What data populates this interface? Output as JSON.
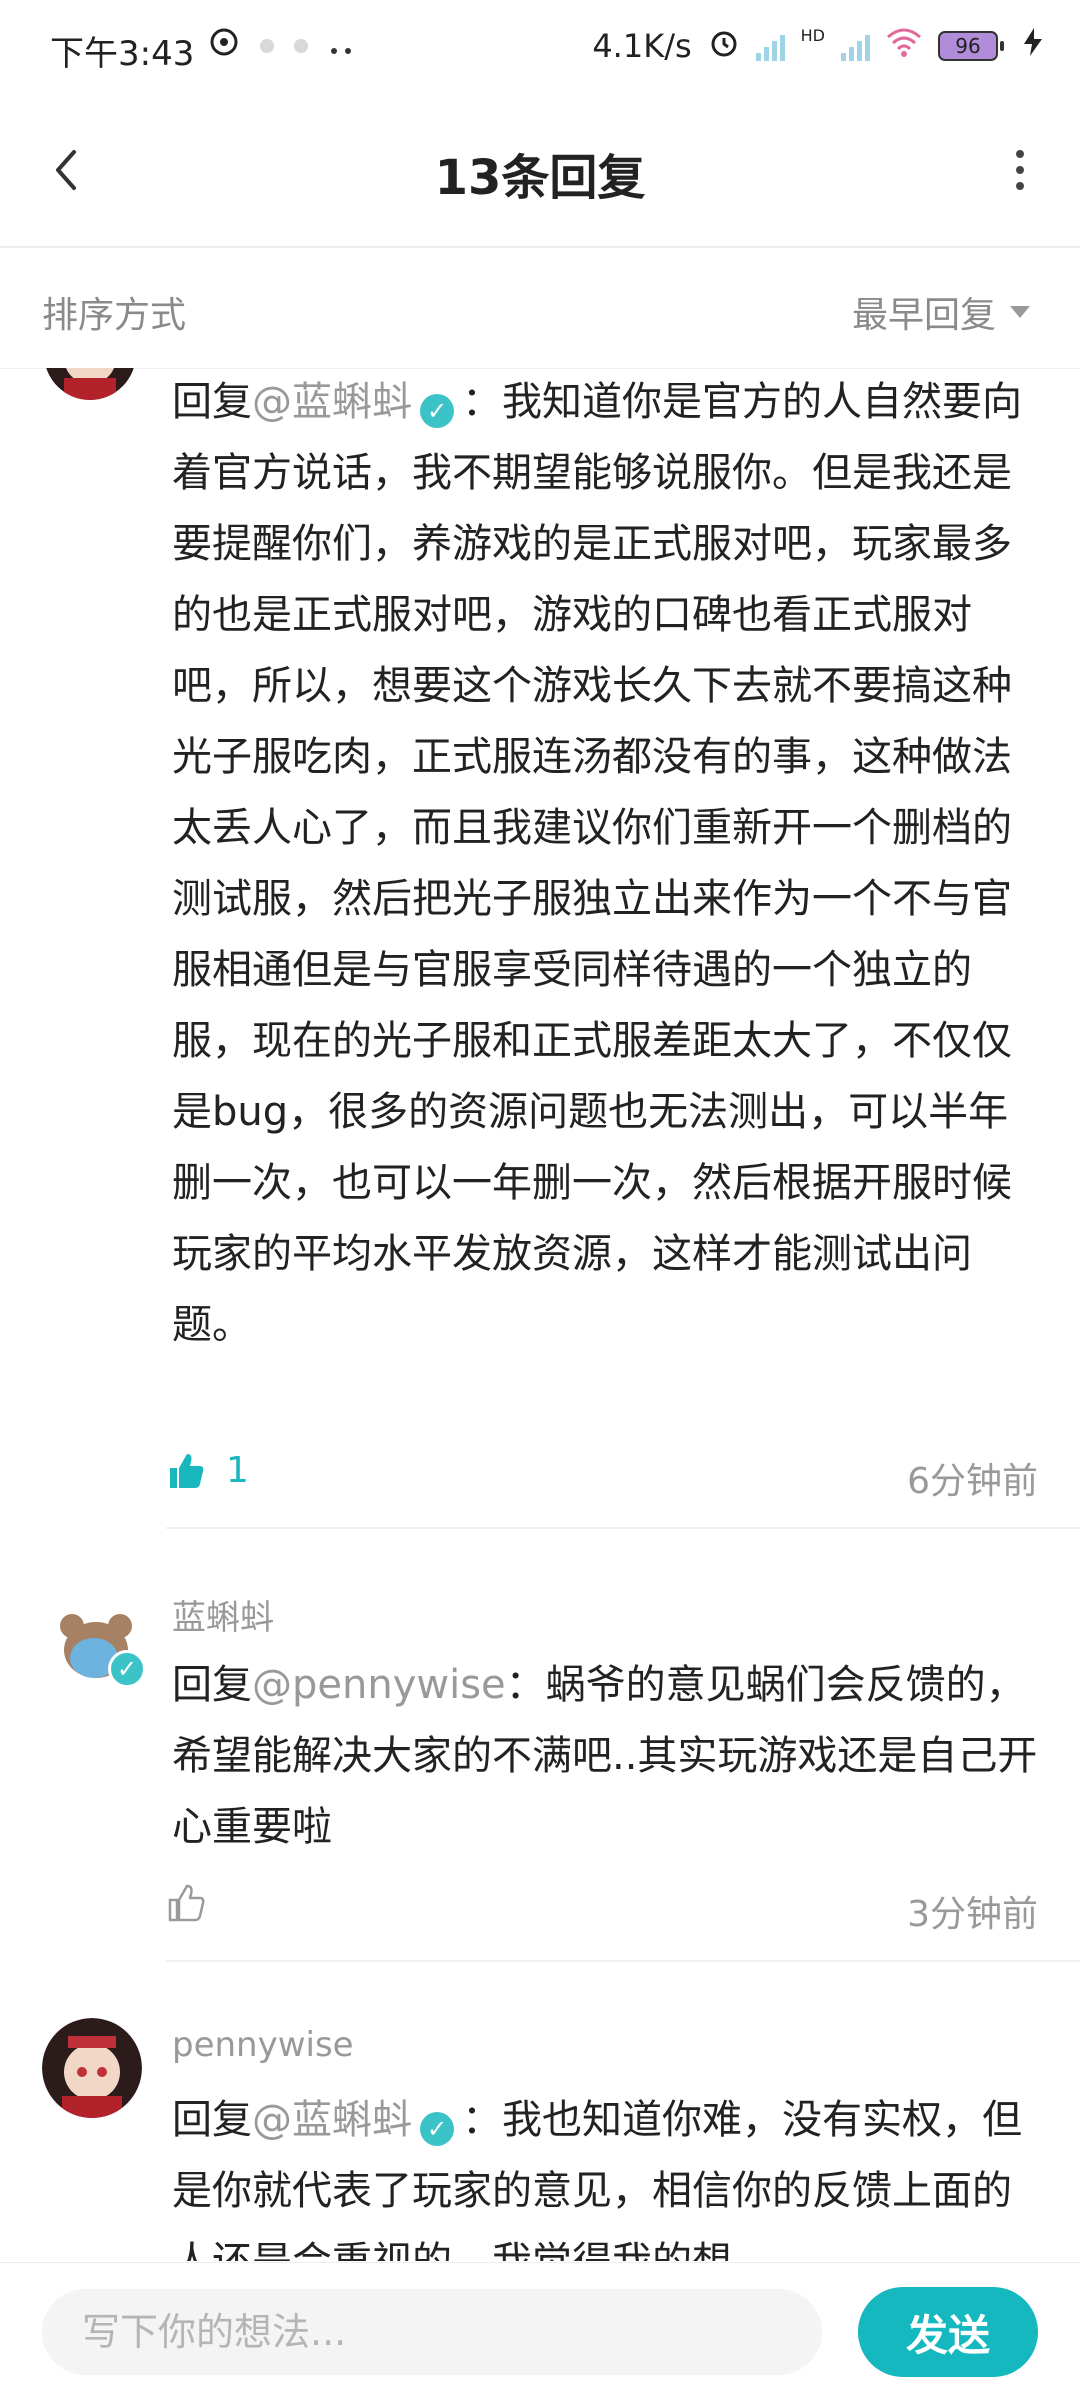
{
  "status_bar": {
    "time": "下午3:43",
    "net_speed": "4.1K/s",
    "hd": "HD",
    "battery": "96"
  },
  "header": {
    "title": "13条回复"
  },
  "sort": {
    "label": "排序方式",
    "selected": "最早回复"
  },
  "comments": [
    {
      "reply_prefix": "回复",
      "mention": "@蓝蝌蚪",
      "text": "：我知道你是官方的人自然要向着官方说话，我不期望能够说服你。但是我还是要提醒你们，养游戏的是正式服对吧，玩家最多的也是正式服对吧，游戏的口碑也看正式服对吧，所以，想要这个游戏长久下去就不要搞这种光子服吃肉，正式服连汤都没有的事，这种做法太丢人心了，而且我建议你们重新开一个删档的测试服，然后把光子服独立出来作为一个不与官服相通但是与官服享受同样待遇的一个独立的服，现在的光子服和正式服差距太大了，不仅仅是bug，很多的资源问题也无法测出，可以半年删一次，也可以一年删一次，然后根据开服时候玩家的平均水平发放资源，这样才能测试出问题。",
      "likes": "1",
      "time": "6分钟前"
    },
    {
      "username": "蓝蝌蚪",
      "reply_prefix": "回复",
      "mention": "@pennywise",
      "text": "：蜗爷的意见蜗们会反馈的，希望能解决大家的不满吧..其实玩游戏还是自己开心重要啦",
      "time": "3分钟前"
    },
    {
      "username": "pennywise",
      "reply_prefix": "回复",
      "mention": "@蓝蝌蚪",
      "text": "：我也知道你难，没有实权，但是你就代表了玩家的意见，相信你的反馈上面的人还是会重视的，我觉得我的想"
    }
  ],
  "composer": {
    "placeholder": "写下你的想法...",
    "send_label": "发送"
  },
  "colors": {
    "accent": "#15b8bf",
    "muted_text": "#999999"
  }
}
